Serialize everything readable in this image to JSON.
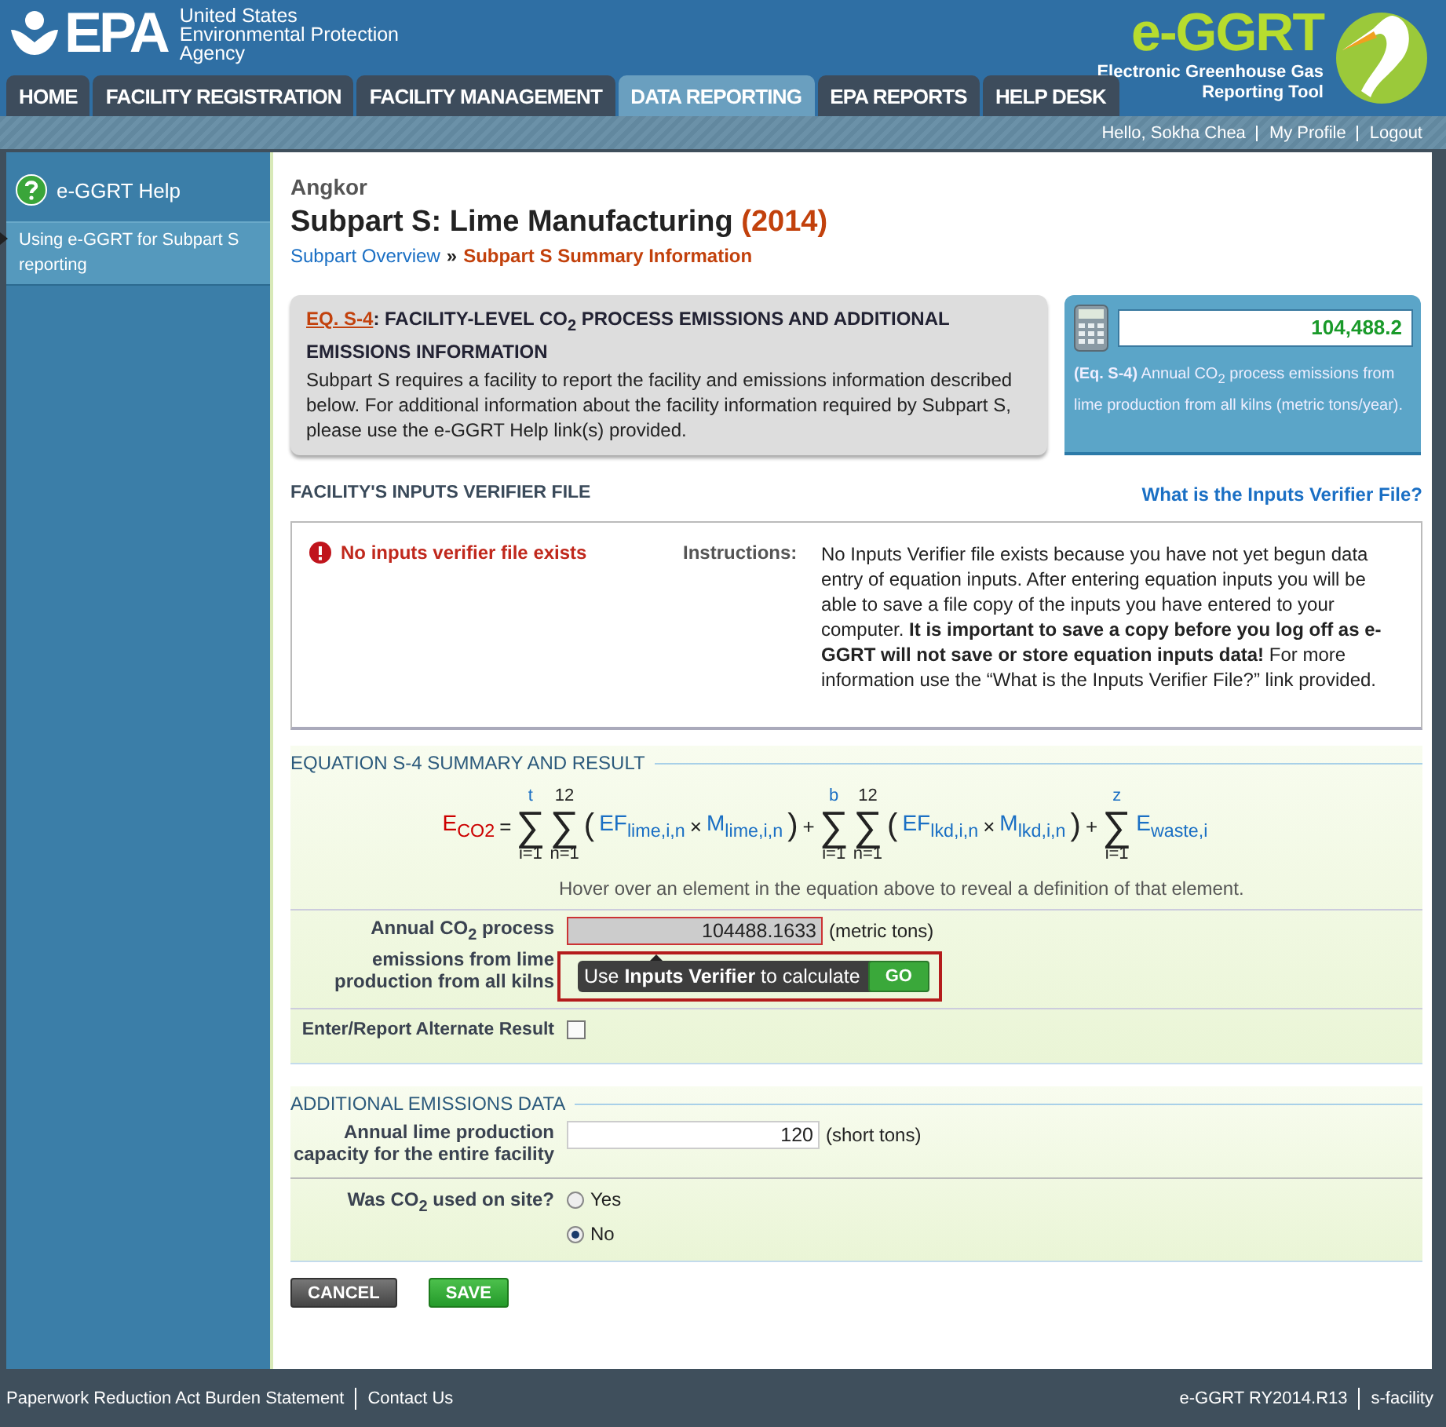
{
  "header": {
    "logo_text": "EPA",
    "agency": [
      "United States",
      "Environmental Protection",
      "Agency"
    ],
    "tool_name": "e-GGRT",
    "tool_subtitle": [
      "Electronic Greenhouse Gas",
      "Reporting Tool"
    ]
  },
  "tabs": [
    {
      "label": "HOME",
      "selected": false
    },
    {
      "label": "FACILITY REGISTRATION",
      "selected": false
    },
    {
      "label": "FACILITY MANAGEMENT",
      "selected": false
    },
    {
      "label": "DATA REPORTING",
      "selected": true
    },
    {
      "label": "EPA REPORTS",
      "selected": false
    },
    {
      "label": "HELP DESK",
      "selected": false
    }
  ],
  "user_links": [
    "Hello, Sokha Chea",
    "My Profile",
    "Logout"
  ],
  "sidebar": {
    "title": "e-GGRT Help",
    "items": [
      {
        "label": "Using e-GGRT for Subpart S reporting",
        "selected": true
      }
    ]
  },
  "facility": "Angkor",
  "page_title": "Subpart S: Lime Manufacturing",
  "year": "(2014)",
  "breadcrumb": {
    "items": [
      "Subpart Overview",
      "Subpart S Summary Information"
    ],
    "separator": "»"
  },
  "info_box": {
    "link": "EQ. S-4",
    "heading": ": FACILITY-LEVEL CO$_{2}$ PROCESS EMISSIONS AND ADDITIONAL EMISSIONS INFORMATION",
    "body": "Subpart S requires a facility to report the facility and emissions information described below. For additional information about the facility information required by Subpart S, please use the e-GGRT Help link(s) provided."
  },
  "result_box": {
    "value": "104,488.2",
    "caption": "**(Eq. S-4)** Annual CO$_{2}$ process emissions from lime production from all kilns (metric tons/year)."
  },
  "verifier": {
    "title": "FACILITY'S INPUTS VERIFIER FILE",
    "help_link": "What is the Inputs Verifier File?",
    "status": "No inputs verifier file exists",
    "instructions_label": "Instructions:",
    "instructions": "No Inputs Verifier file exists because you have not yet begun data entry of equation inputs.  After entering equation inputs you will be able to save a file copy of the inputs you have entered to your computer.  **It is important to save a copy before you log off as e-GGRT will not save or store equation inputs data!** For more information use the “What is the Inputs Verifier File?” link provided."
  },
  "equation_section": {
    "title": "EQUATION S-4 SUMMARY AND RESULT",
    "terms": [
      {
        "kind": "var",
        "text": "E$_{CO2}$",
        "color": "#cc0000"
      },
      {
        "kind": "op",
        "text": "="
      },
      {
        "kind": "sum",
        "symbol": "∑",
        "top": {
          "kind": "var",
          "text": "t"
        },
        "bottom": "i=1"
      },
      {
        "kind": "sum",
        "symbol": "∑",
        "top": {
          "kind": "const",
          "text": "12"
        },
        "bottom": "n=1"
      },
      {
        "kind": "paren",
        "text": "("
      },
      {
        "kind": "var",
        "text": "EF$_{lime,i,n}$",
        "color": "#1a6fc4"
      },
      {
        "kind": "op",
        "text": "×"
      },
      {
        "kind": "var",
        "text": "M$_{lime,i,n}$",
        "color": "#1a6fc4"
      },
      {
        "kind": "paren",
        "text": ")"
      },
      {
        "kind": "op",
        "text": "+"
      },
      {
        "kind": "sum",
        "symbol": "∑",
        "top": {
          "kind": "var",
          "text": "b"
        },
        "bottom": "i=1"
      },
      {
        "kind": "sum",
        "symbol": "∑",
        "top": {
          "kind": "const",
          "text": "12"
        },
        "bottom": "n=1"
      },
      {
        "kind": "paren",
        "text": "("
      },
      {
        "kind": "var",
        "text": "EF$_{lkd,i,n}$",
        "color": "#1a6fc4"
      },
      {
        "kind": "op",
        "text": "×"
      },
      {
        "kind": "var",
        "text": "M$_{lkd,i,n}$",
        "color": "#1a6fc4"
      },
      {
        "kind": "paren",
        "text": ")"
      },
      {
        "kind": "op",
        "text": "+"
      },
      {
        "kind": "sum",
        "symbol": "∑",
        "top": {
          "kind": "var",
          "text": "z"
        },
        "bottom": "i=1"
      },
      {
        "kind": "var",
        "text": "E$_{waste,i}$",
        "color": "#1a6fc4"
      }
    ],
    "hint": "Hover over an element in the equation above to reveal a definition of that element.",
    "result": {
      "label": "Annual CO$_{2}$ process emissions from lime production from all kilns",
      "value": "104488.1633",
      "unit": "(metric tons)",
      "tooltip": "Use **Inputs Verifier** to calculate",
      "tooltip_button": "GO"
    },
    "alternate": {
      "label": "Enter/Report Alternate Result",
      "checked": false
    }
  },
  "additional": {
    "title": "ADDITIONAL EMISSIONS DATA",
    "capacity": {
      "label": "Annual lime production capacity for the entire facility",
      "value": "120",
      "unit": "(short tons)"
    },
    "co2_used": {
      "label": "Was CO$_{2}$ used on site?",
      "options": [
        {
          "label": "Yes",
          "selected": false
        },
        {
          "label": "No",
          "selected": true
        }
      ]
    }
  },
  "buttons": [
    {
      "label": "CANCEL",
      "kind": "cancel"
    },
    {
      "label": "SAVE",
      "kind": "save"
    }
  ],
  "footer": {
    "left": [
      "Paperwork Reduction Act Burden Statement",
      "Contact Us"
    ],
    "right": [
      "e-GGRT RY2014.R13",
      "s-facility"
    ]
  }
}
